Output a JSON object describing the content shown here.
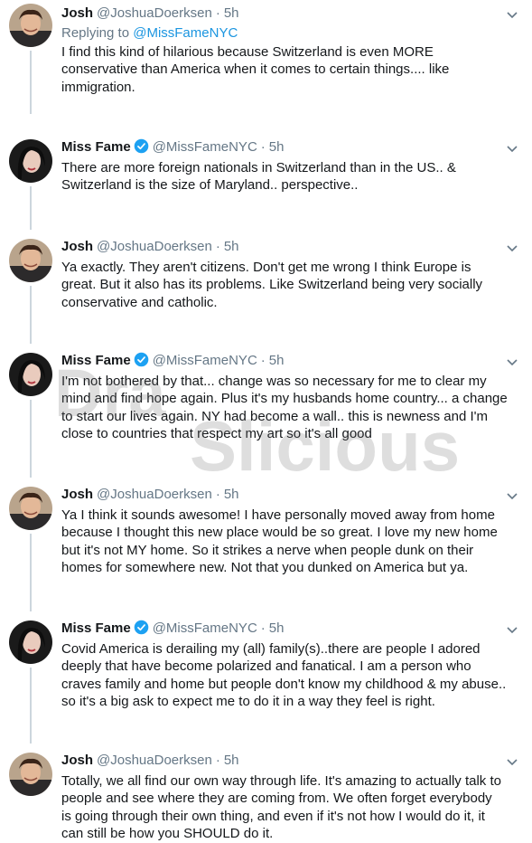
{
  "tweets": [
    {
      "name": "Josh",
      "handle": "@JoshuaDoerksen",
      "time": "5h",
      "reply_prefix": "Replying to ",
      "reply_handle": "@MissFameNYC",
      "text": "I find this kind of hilarious because Switzerland is even MORE\nconservative than America when it comes to certain things.... like\nimmigration."
    },
    {
      "name": "Miss Fame",
      "handle": "@MissFameNYC",
      "time": "5h",
      "text": "There are more foreign nationals in Switzerland than in the US.. &\nSwitzerland is the size of Maryland.. perspective.."
    },
    {
      "name": "Josh",
      "handle": "@JoshuaDoerksen",
      "time": "5h",
      "text": "Ya exactly.  They aren't citizens.  Don't get me wrong I think Europe is\ngreat.  But it also has its problems.  Like Switzerland being very socially\nconservative and catholic."
    },
    {
      "name": "Miss Fame",
      "handle": "@MissFameNYC",
      "time": "5h",
      "text": "I'm not bothered by that... change was so necessary for me to clear my\nmind and find hope again. Plus it's my husbands home country... a change\nto start our lives again. NY had become a wall.. this is newness and I'm\nclose to countries that respect my art so it's all good"
    },
    {
      "name": "Josh",
      "handle": "@JoshuaDoerksen",
      "time": "5h",
      "text": "Ya I think it sounds awesome! I have personally moved away from home\nbecause I thought this new place would be so great.  I love my new home\nbut it's not MY home.  So it strikes a nerve when people dunk on their\nhomes for somewhere new.  Not that you dunked on America but ya."
    },
    {
      "name": "Miss Fame",
      "handle": "@MissFameNYC",
      "time": "5h",
      "text": "Covid America is derailing my (all) family(s)..there are people I adored\ndeeply that have become polarized and fanatical. I am a person who\ncraves family and home but people don't know my childhood & my abuse..\nso it's a big ask to expect me to do it in a way they feel is right."
    },
    {
      "name": "Josh",
      "handle": "@JoshuaDoerksen",
      "time": "5h",
      "text": "Totally, we all find our own way through life.  It's amazing to actually talk to\npeople and see where they are coming from.  We often forget everybody\nis going through their own thing, and even if it's not how I would do it, it\ncan still be how you SHOULD do it."
    }
  ],
  "watermark": {
    "line1": "Dra",
    "line2": "Slicious"
  },
  "colors": {
    "link": "#1b95e0",
    "muted": "#657786",
    "verified": "#1da1f2",
    "line": "#ccd6dd"
  },
  "icons": {
    "verified": "verified-badge-icon",
    "caret": "chevron-down-icon"
  }
}
